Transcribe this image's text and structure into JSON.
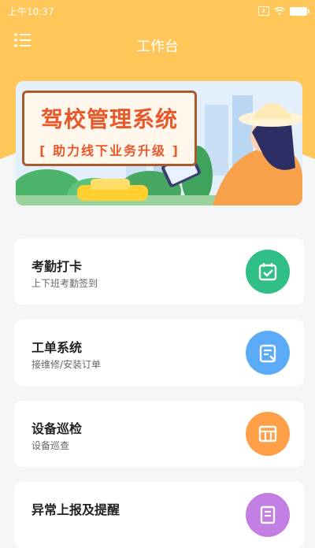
{
  "status_bar": {
    "time": "上午10:37",
    "sim_label": "x"
  },
  "header": {
    "title": "工作台"
  },
  "banner": {
    "title": "驾校管理系统",
    "subtitle": "[ 助力线下业务升级 ]"
  },
  "cards": [
    {
      "title": "考勤打卡",
      "subtitle": "上下班考勤签到",
      "icon": "calendar-check-icon",
      "color": "#2fbf87"
    },
    {
      "title": "工单系统",
      "subtitle": "接维修/安装订单",
      "icon": "work-order-icon",
      "color": "#5aaaf5"
    },
    {
      "title": "设备巡检",
      "subtitle": "设备巡查",
      "icon": "device-inspection-icon",
      "color": "#ff9f48"
    },
    {
      "title": "异常上报及提醒",
      "subtitle": "",
      "icon": "report-icon",
      "color": "#c37ee3"
    }
  ]
}
